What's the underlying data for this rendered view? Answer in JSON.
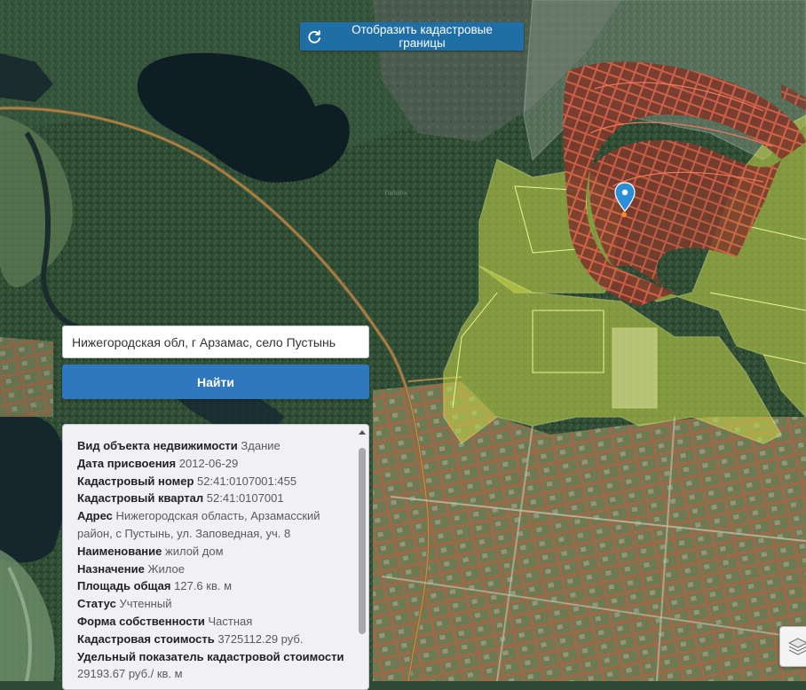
{
  "toolbar": {
    "cadastral_button_label": "Отобразить кадастровые границы"
  },
  "search": {
    "query": "Нижегородская обл, г Арзамас, село Пустынь",
    "find_button_label": "Найти"
  },
  "property": {
    "fields": [
      {
        "label": "Вид объекта недвижимости",
        "value": "Здание"
      },
      {
        "label": "Дата присвоения",
        "value": "2012-06-29"
      },
      {
        "label": "Кадастровый номер",
        "value": "52:41:0107001:455"
      },
      {
        "label": "Кадастровый квартал",
        "value": "52:41:0107001"
      },
      {
        "label": "Адрес",
        "value": "Нижегородская область, Арзамасский район, с Пустынь, ул. Заповедная, уч. 8"
      },
      {
        "label": "Наименование",
        "value": "жилой дом"
      },
      {
        "label": "Назначение",
        "value": "Жилое"
      },
      {
        "label": "Площадь общая",
        "value": "127.6 кв. м"
      },
      {
        "label": "Статус",
        "value": "Учтенный"
      },
      {
        "label": "Форма собственности",
        "value": "Частная"
      },
      {
        "label": "Кадастровая стоимость",
        "value": "3725112.29 руб."
      },
      {
        "label": "Удельный показатель кадастровой стоимости",
        "value": "29193.67 руб./ кв. м"
      }
    ]
  },
  "icons": {
    "refresh": "refresh-icon",
    "marker": "location-marker-icon",
    "layers": "layers-icon"
  },
  "colors": {
    "button_dark": "#1f6fa6",
    "button_primary": "#2f78bf",
    "parcel_yellow": "#c8d84a",
    "parcel_red": "#d9533d",
    "marker_blue": "#2a8fd6"
  }
}
